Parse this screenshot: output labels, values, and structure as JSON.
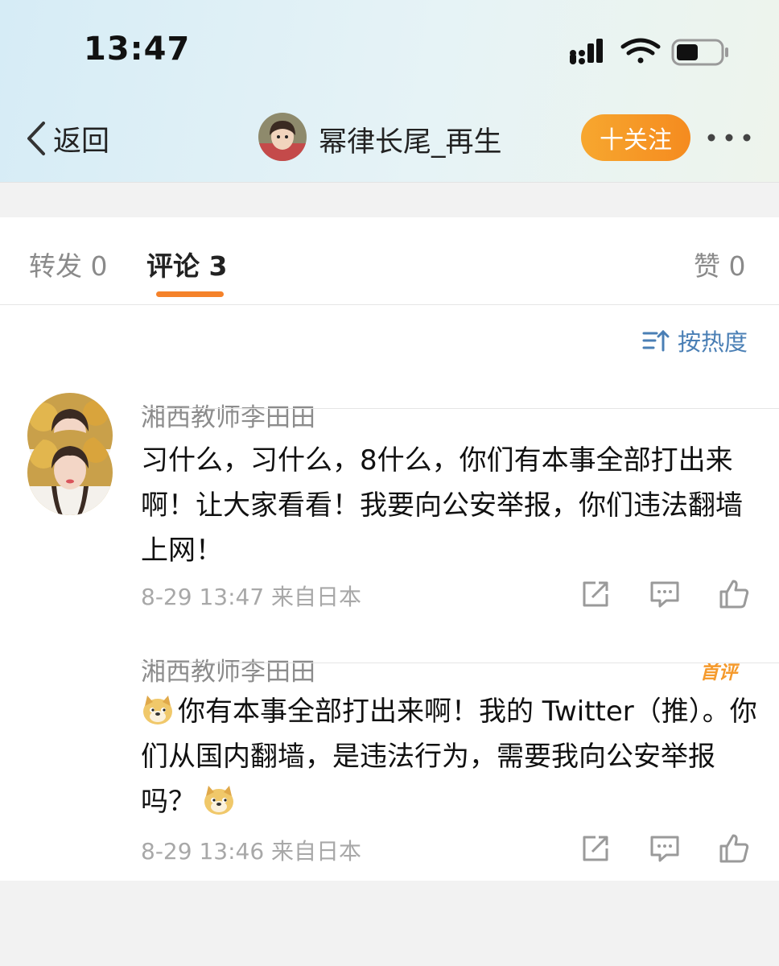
{
  "status_bar": {
    "time": "13:47"
  },
  "nav": {
    "back_label": "返回",
    "profile_name": "幂律长尾_再生",
    "follow_label": "十关注"
  },
  "tabs": [
    {
      "label": "转发 0"
    },
    {
      "label": "评论 3"
    },
    {
      "label": "赞 0"
    }
  ],
  "sort": {
    "label": "按热度"
  },
  "comments": [
    {
      "user": "湘西教师李田田",
      "text": "习什么，习什么，8什么，你们有本事全部打出来啊！让大家看看！我要向公安举报，你们违法翻墙上网！",
      "meta": "8-29 13:47 来自日本"
    },
    {
      "user": "湘西教师李田田",
      "badge": "首评",
      "text_part1": "你有本事全部打出来啊！我的 Twitter（推）。你们从国内翻墙，是违法行为，需要我向公安举报吗？",
      "meta": "8-29 13:46 来自日本"
    }
  ],
  "colors": {
    "accent": "#f5822a",
    "link": "#4a7fb5"
  }
}
